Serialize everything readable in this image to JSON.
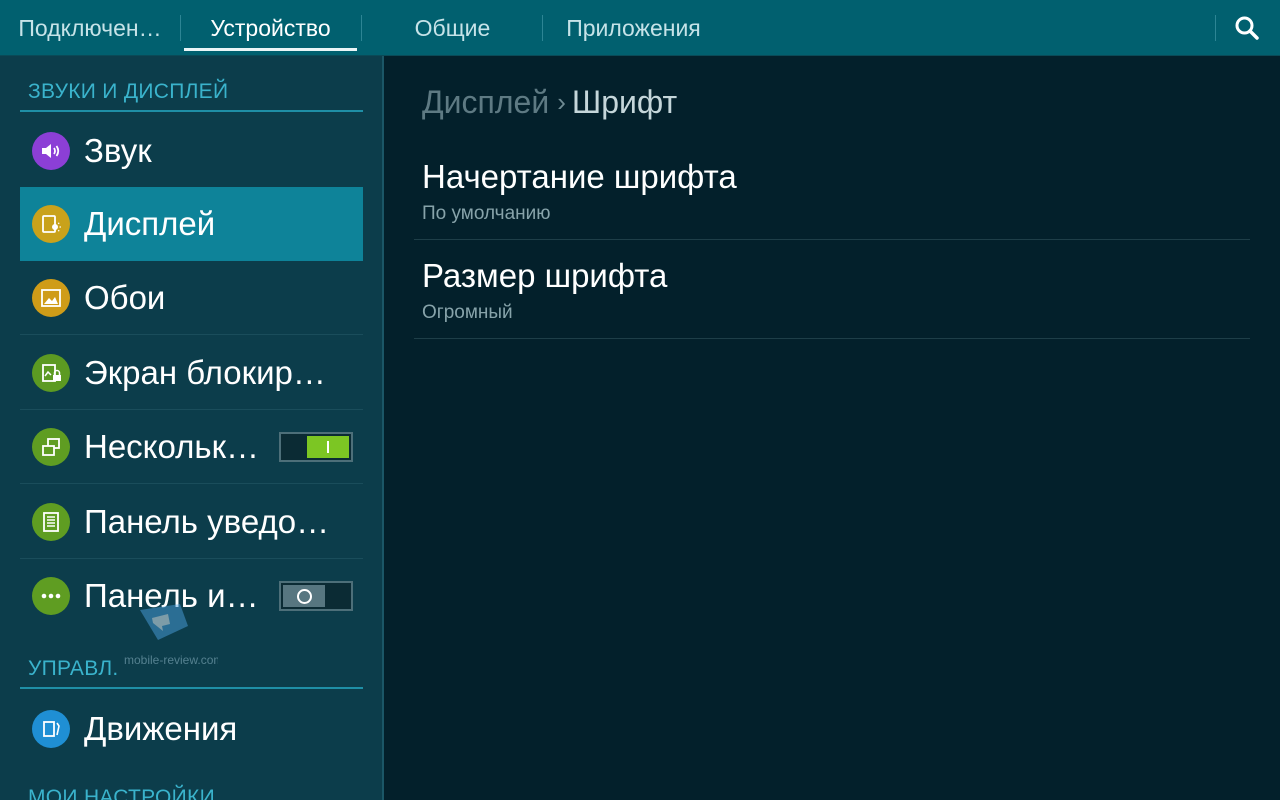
{
  "tabs": [
    {
      "label": "Подключен…"
    },
    {
      "label": "Устройство"
    },
    {
      "label": "Общие"
    },
    {
      "label": "Приложения"
    }
  ],
  "active_tab": "Устройство",
  "search_icon": "search-icon",
  "sections": {
    "sound_display": "ЗВУКИ И ДИСПЛЕЙ",
    "control": "УПРАВЛ.",
    "my_settings": "МОИ НАСТРОЙКИ"
  },
  "menu": [
    {
      "label": "Звук",
      "icon": "speaker-icon",
      "color": "#8c3fd6"
    },
    {
      "label": "Дисплей",
      "icon": "display-icon",
      "color": "#c9a21b",
      "selected": true
    },
    {
      "label": "Обои",
      "icon": "image-icon",
      "color": "#cf9c18"
    },
    {
      "label": "Экран блокир…",
      "icon": "lock-screen-icon",
      "color": "#5c9a22"
    },
    {
      "label": "Нескольк…",
      "icon": "multi-window-icon",
      "color": "#5f9d22",
      "toggle": "on"
    },
    {
      "label": "Панель уведо…",
      "icon": "notification-panel-icon",
      "color": "#5f9d22"
    },
    {
      "label": "Панель и…",
      "icon": "more-icon",
      "color": "#5f9d22",
      "toggle": "off"
    },
    {
      "label": "Движения",
      "icon": "motion-icon",
      "color": "#1f8fd4"
    }
  ],
  "watermark": "mobile-review.com",
  "breadcrumb": {
    "parent": "Дисплей",
    "separator": "›",
    "current": "Шрифт"
  },
  "settings": [
    {
      "title": "Начертание шрифта",
      "value": "По умолчанию"
    },
    {
      "title": "Размер шрифта",
      "value": "Огромный"
    }
  ],
  "colors": {
    "topbar": "#01606f",
    "left_pane": "#0c3d4b",
    "right_pane": "#03202b",
    "selected_item": "#0e8399",
    "section_header": "#3ab3cc",
    "toggle_on": "#7cc623"
  }
}
